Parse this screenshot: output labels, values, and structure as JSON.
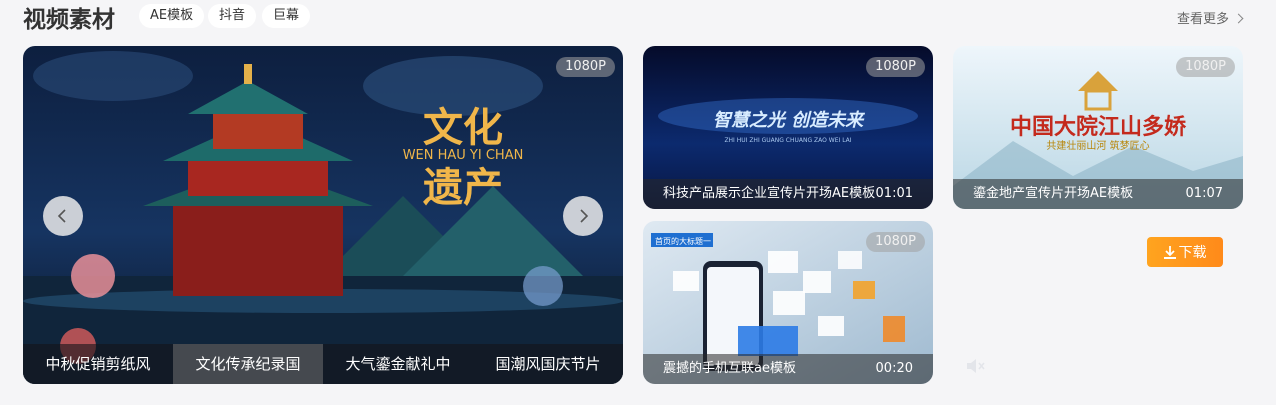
{
  "header": {
    "title": "视频素材",
    "tags": [
      "AE模板",
      "抖音",
      "巨幕"
    ],
    "more_label": "查看更多"
  },
  "main_card": {
    "badge": "1080P",
    "art_title_line1": "文化",
    "art_subtitle": "WEN HAU YI CHAN",
    "art_title_line2": "遗产",
    "tabs": [
      "中秋促销剪纸风",
      "文化传承纪录国",
      "大气鎏金献礼中",
      "国潮风国庆节片"
    ],
    "active_tab": 1
  },
  "cards": [
    {
      "badge": "1080P",
      "title": "科技产品展示企业宣传片开场AE模板",
      "duration": "01:01",
      "art_text": "智慧之光 创造未来",
      "art_sub": "ZHI HUI ZHI GUANG CHUANG ZAO WEI LAI"
    },
    {
      "badge": "1080P",
      "title": "鎏金地产宣传片开场AE模板",
      "duration": "01:07",
      "art_text": "中国大院江山多娇",
      "art_sub": "共建壮丽山河 筑梦匠心"
    },
    {
      "badge": "1080P",
      "title": "震撼的手机互联ae模板",
      "duration": "00:20",
      "art_text": "首页的大标题一"
    }
  ],
  "download_label": "下载",
  "colors": {
    "accent": "#ff9a1f",
    "background": "#f5f5f7"
  }
}
